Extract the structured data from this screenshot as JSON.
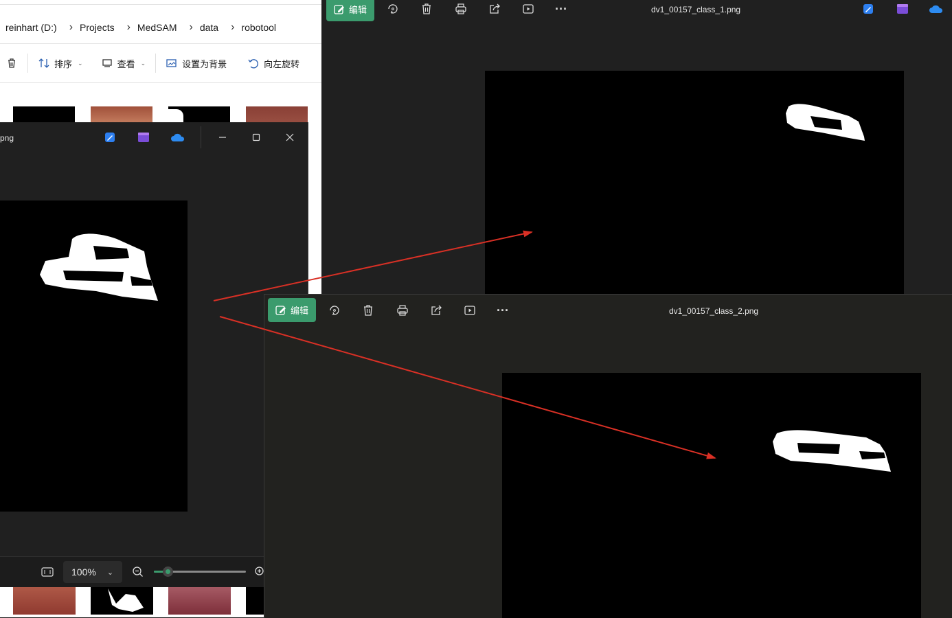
{
  "explorer": {
    "breadcrumb": [
      "reinhart (D:)",
      "Projects",
      "MedSAM",
      "data",
      "robotool"
    ],
    "toolbar": {
      "sort_label": "排序",
      "view_label": "查看",
      "set_bg_label": "设置为背景",
      "rotate_left_label": "向左旋转"
    }
  },
  "viewer_left": {
    "title": "png",
    "zoom_value": "100%",
    "zoom_level": 0.15
  },
  "viewer_top": {
    "edit_label": "编辑",
    "title": "dv1_00157_class_1.png"
  },
  "viewer_bottom": {
    "edit_label": "编辑",
    "title": "dv1_00157_class_2.png"
  },
  "colors": {
    "accent_green": "#3b9b6d",
    "arrow_red": "#d93025",
    "viewer_bg": "#202020"
  }
}
